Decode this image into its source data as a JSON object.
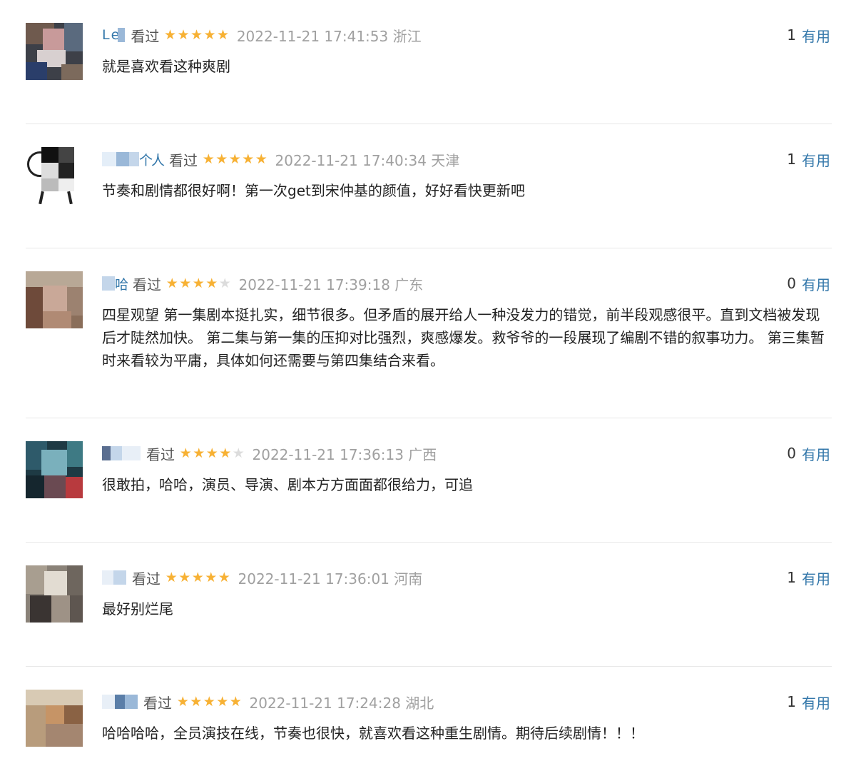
{
  "comments": [
    {
      "user": "L e",
      "status": "看过",
      "rating": 5,
      "time": "2022-11-21 17:41:53",
      "location": "浙江",
      "votes": "1",
      "vote_label": "有用",
      "text": "就是喜欢看这种爽剧"
    },
    {
      "user": "个人",
      "status": "看过",
      "rating": 5,
      "time": "2022-11-21 17:40:34",
      "location": "天津",
      "votes": "1",
      "vote_label": "有用",
      "text": "节奏和剧情都很好啊！第一次get到宋仲基的颜值，好好看快更新吧"
    },
    {
      "user": "哈",
      "status": "看过",
      "rating": 4,
      "time": "2022-11-21 17:39:18",
      "location": "广东",
      "votes": "0",
      "vote_label": "有用",
      "text": "四星观望 第一集剧本挺扎实，细节很多。但矛盾的展开给人一种没发力的错觉，前半段观感很平。直到文档被发现后才陡然加快。 第二集与第一集的压抑对比强烈，爽感爆发。救爷爷的一段展现了编剧不错的叙事功力。 第三集暂时来看较为平庸，具体如何还需要与第四集结合来看。"
    },
    {
      "user": "",
      "status": "看过",
      "rating": 4,
      "time": "2022-11-21 17:36:13",
      "location": "广西",
      "votes": "0",
      "vote_label": "有用",
      "text": "很敢拍，哈哈，演员、导演、剧本方方面面都很给力，可追"
    },
    {
      "user": "",
      "status": "看过",
      "rating": 5,
      "time": "2022-11-21 17:36:01",
      "location": "河南",
      "votes": "1",
      "vote_label": "有用",
      "text": "最好别烂尾"
    },
    {
      "user": "",
      "status": "看过",
      "rating": 5,
      "time": "2022-11-21 17:24:28",
      "location": "湖北",
      "votes": "1",
      "vote_label": "有用",
      "text": "哈哈哈哈，全员演技在线，节奏也很快，就喜欢看这种重生剧情。期待后续剧情！！！"
    }
  ]
}
